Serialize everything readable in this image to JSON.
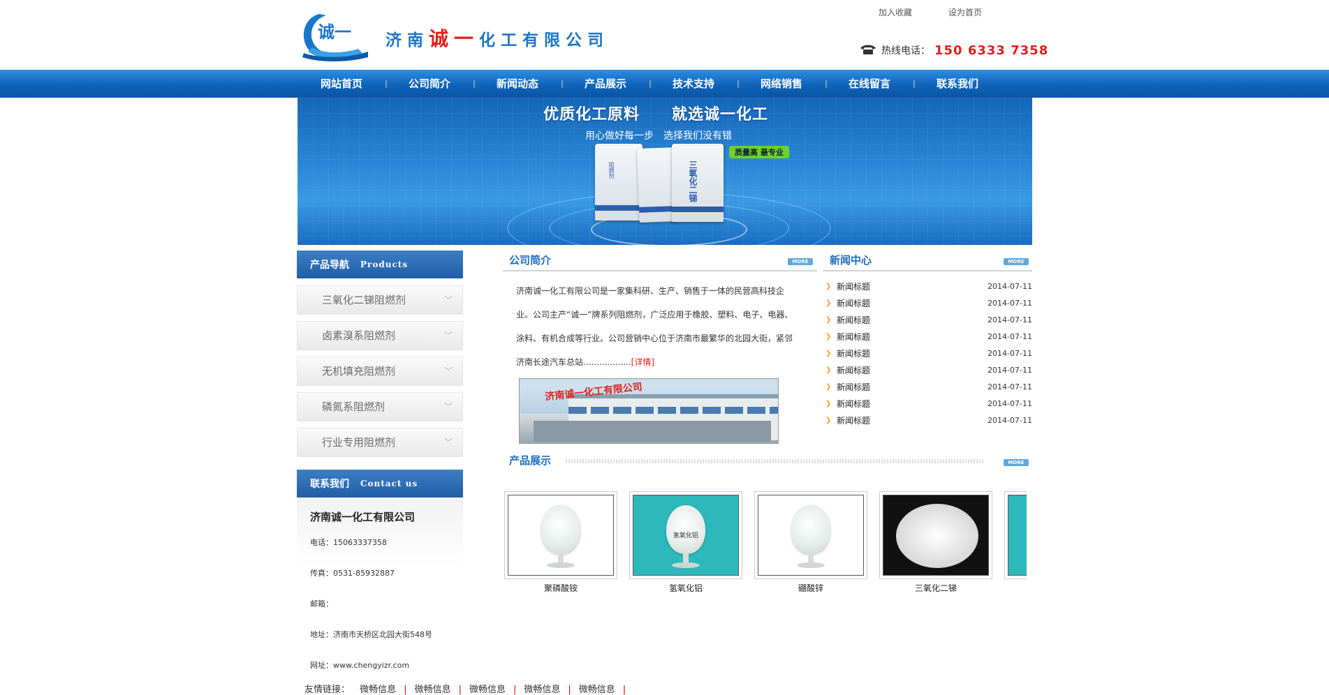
{
  "header": {
    "company_name_part1": "济南",
    "company_name_part2": "诚一",
    "company_name_part3": "化工有限公司",
    "logo_text": "诚一",
    "bookmark_link": "加入收藏",
    "homepage_link": "设为首页",
    "hotline_label": "热线电话：",
    "hotline_number": "150 6333 7358"
  },
  "nav": {
    "items": [
      "网站首页",
      "公司简介",
      "新闻动态",
      "产品展示",
      "技术支持",
      "网络销售",
      "在线留言",
      "联系我们"
    ]
  },
  "banner": {
    "title": "优质化工原料　　就选诚一化工",
    "subtitle": "用心做好每一步　选择我们没有错",
    "tag": "质量高 最专业",
    "bag_labels": [
      "阻燃剂",
      "三氧化二锑"
    ]
  },
  "sidebar": {
    "products_title": "产品导航",
    "products_title_en": "Products",
    "product_items": [
      "三氧化二锑阻燃剂",
      "卤素溴系阻燃剂",
      "无机填充阻燃剂",
      "磷氮系阻燃剂",
      "行业专用阻燃剂"
    ],
    "contact_title": "联系我们",
    "contact_title_en": "Contact us",
    "contact": {
      "company": "济南诚一化工有限公司",
      "phone": "电话：15063337358",
      "fax": "传真：0531-85932887",
      "email": "邮箱：",
      "address": "地址：济南市天桥区北园大街548号",
      "website": "网址：www.chengyizr.com"
    }
  },
  "intro": {
    "title": "公司简介",
    "more": "MORE",
    "text": "济南诚一化工有限公司是一家集科研、生产、销售于一体的民营高科技企业。公司主产“诚一”牌系列阻燃剂，广泛应用于橡胶、塑料、电子、电器、涂料、有机合成等行业。公司营销中心位于济南市最繁华的北园大街，紧邻济南长途汽车总站..................",
    "details_link": "[详情]",
    "image_sign": "济南诚一化工有限公司"
  },
  "news": {
    "title": "新闻中心",
    "more": "MORE",
    "items": [
      {
        "title": "新闻标题",
        "date": "2014-07-11"
      },
      {
        "title": "新闻标题",
        "date": "2014-07-11"
      },
      {
        "title": "新闻标题",
        "date": "2014-07-11"
      },
      {
        "title": "新闻标题",
        "date": "2014-07-11"
      },
      {
        "title": "新闻标题",
        "date": "2014-07-11"
      },
      {
        "title": "新闻标题",
        "date": "2014-07-11"
      },
      {
        "title": "新闻标题",
        "date": "2014-07-11"
      },
      {
        "title": "新闻标题",
        "date": "2014-07-11"
      },
      {
        "title": "新闻标题",
        "date": "2014-07-11"
      }
    ]
  },
  "products": {
    "title": "产品展示",
    "more": "MORE",
    "items": [
      {
        "name": "聚磷酸铵",
        "bg": "#ffffff"
      },
      {
        "name": "氢氧化铝",
        "bg": "#2db8bc",
        "flask_label": "氢氧化铝"
      },
      {
        "name": "硼酸锌",
        "bg": "#ffffff"
      },
      {
        "name": "三氧化二锑",
        "bg": "#111111"
      },
      {
        "name": "-",
        "bg": "#2db8bc"
      }
    ]
  },
  "footer": {
    "links_label": "友情链接：",
    "links": [
      "微畅信息",
      "微畅信息",
      "微畅信息",
      "微畅信息",
      "微畅信息"
    ]
  },
  "colors": {
    "brand_blue": "#1e6dbf",
    "nav_blue": "#0f63b8",
    "accent_red": "#e0201c",
    "tag_green": "#6fd12c"
  }
}
